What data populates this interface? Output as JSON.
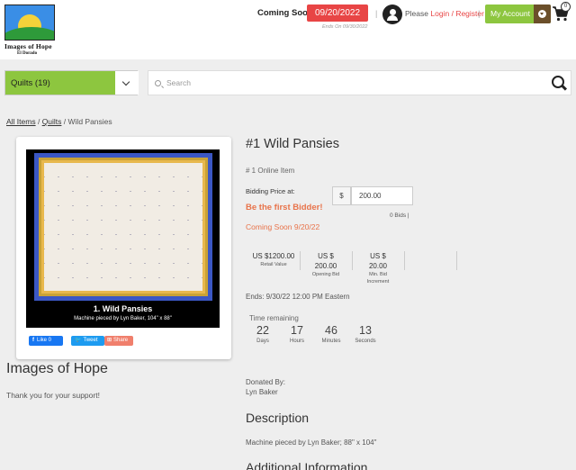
{
  "header": {
    "logo_title": "Images of Hope",
    "logo_sub": "El Dorado",
    "coming_label": "Coming Soon",
    "start_date": "09/20/2022",
    "ends_note": "Ends On 09/30/2022",
    "please_text": "Please",
    "login_label": "Login",
    "slash": "/",
    "register_label": "Register",
    "separator": "|",
    "account_label": "My Account",
    "cart_count": "0"
  },
  "search": {
    "category_label": "Quilts (19)",
    "placeholder": "Search"
  },
  "breadcrumb": {
    "all_items": "All Items",
    "sep1": " / ",
    "category": "Quilts",
    "sep2": " / ",
    "current": "Wild Pansies"
  },
  "image": {
    "caption_title": "1. Wild Pansies",
    "caption_sub": "Machine pieced by Lyn Baker, 104\" x 88\""
  },
  "social": {
    "like_label": "Like 0",
    "tweet_label": "Tweet",
    "share_label": "Share"
  },
  "org": {
    "name": "Images of Hope",
    "thanks": "Thank you for your support!"
  },
  "item": {
    "title": "#1 Wild Pansies",
    "subtitle": "# 1 Online Item",
    "bid_label": "Bidding Price at:",
    "currency": "$",
    "bid_value": "200.00",
    "bids_count": "0 Bids |",
    "first_bidder": "Be the first Bidder!",
    "coming_soon": "Coming Soon 9/20/22",
    "stats": [
      {
        "value": "US $1200.00",
        "label": "Retail Value"
      },
      {
        "value_line1": "US $",
        "value_line2": "200.00",
        "label": "Opening Bid"
      },
      {
        "value_line1": "US $",
        "value_line2": "20.00",
        "label_line1": "Min. Bid",
        "label_line2": "Increment"
      }
    ],
    "ends": "Ends: 9/30/22 12:00 PM Eastern",
    "time_remaining_label": "Time remaining",
    "countdown": [
      {
        "value": "22",
        "label": "Days"
      },
      {
        "value": "17",
        "label": "Hours"
      },
      {
        "value": "46",
        "label": "Minutes"
      },
      {
        "value": "13",
        "label": "Seconds"
      }
    ],
    "donated_by_label": "Donated By:",
    "donor": "Lyn Baker",
    "description_heading": "Description",
    "description": "Machine pieced by Lyn Baker; 88\" x 104\"",
    "additional_heading": "Additional Information"
  },
  "colors": {
    "accent_green": "#8dc63f",
    "date_red": "#e84545",
    "orange_text": "#e8734a",
    "account_brown": "#6b4f2a"
  }
}
